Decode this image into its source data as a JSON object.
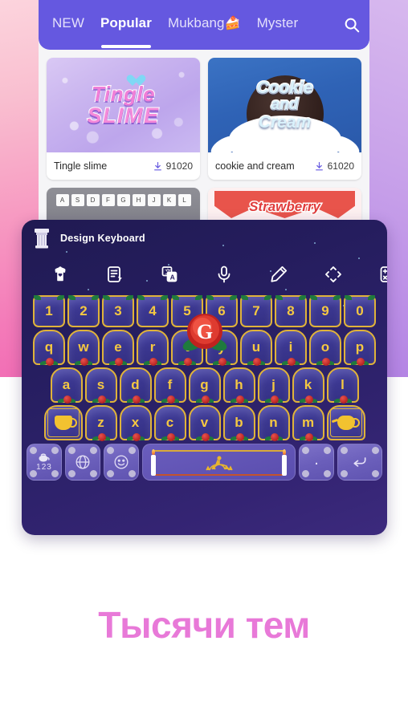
{
  "colors": {
    "topbar": "#6558e0",
    "pink_top": "#fcd4dd",
    "pink_bottom": "#ef5fb0",
    "purple_edge": "#c9a3ea",
    "keyboard_bg": "#251d5e",
    "key_gold": "#e0b33a",
    "key_text": "#f5c842",
    "headline": "#e879d8",
    "download_icon": "#6558e0"
  },
  "store": {
    "tabs": [
      {
        "label": "NEW",
        "emoji": "",
        "active": false
      },
      {
        "label": "Popular",
        "emoji": "",
        "active": true
      },
      {
        "label": "Mukbang",
        "emoji": "🍰",
        "active": false
      },
      {
        "label": "Myster",
        "emoji": "",
        "active": false
      }
    ],
    "search_icon": "search-icon",
    "cards": [
      {
        "name": "Tingle slime",
        "downloads": "91020",
        "art_line1": "Tingle",
        "art_line2": "SLIME"
      },
      {
        "name": "cookie and cream",
        "downloads": "61020",
        "art_line1": "Cookie",
        "art_line2": "and",
        "art_line3": "Cream"
      }
    ],
    "cards_row2": [
      {
        "art_keys": [
          "A",
          "S",
          "D",
          "F",
          "G",
          "H",
          "J",
          "K",
          "L"
        ]
      },
      {
        "art_word": "Strawberry"
      }
    ]
  },
  "keyboard": {
    "title": "Design Keyboard",
    "logo_icon": "column-pillar-icon",
    "brand_letter": "G",
    "toolbar": [
      {
        "icon": "theme-shirt-icon"
      },
      {
        "icon": "quick-text-icon"
      },
      {
        "icon": "translate-icon"
      },
      {
        "icon": "microphone-icon"
      },
      {
        "icon": "pencil-icon"
      },
      {
        "icon": "move-arrows-icon"
      },
      {
        "icon": "calculator-icon"
      }
    ],
    "rows": {
      "numbers": [
        "1",
        "2",
        "3",
        "4",
        "5",
        "6",
        "7",
        "8",
        "9",
        "0"
      ],
      "qwerty": [
        "q",
        "w",
        "e",
        "r",
        "t",
        "y",
        "u",
        "i",
        "o",
        "p"
      ],
      "asdf": [
        "a",
        "s",
        "d",
        "f",
        "g",
        "h",
        "j",
        "k",
        "l"
      ],
      "zxcv": [
        "z",
        "x",
        "c",
        "v",
        "b",
        "n",
        "m"
      ]
    },
    "shift_icon": "teacup-shift-icon",
    "backspace_icon": "teapot-backspace-icon",
    "bottom_row": {
      "numeric_label": "123",
      "numeric_icon": "teapot-small-icon",
      "globe_icon": "globe-language-icon",
      "emoji_icon": "smiley-emoji-icon",
      "space_icon": "candelabra-spacebar-icon",
      "period_label": ".",
      "enter_icon": "enter-return-icon"
    }
  },
  "promo": {
    "headline": "Тысячи тем"
  }
}
